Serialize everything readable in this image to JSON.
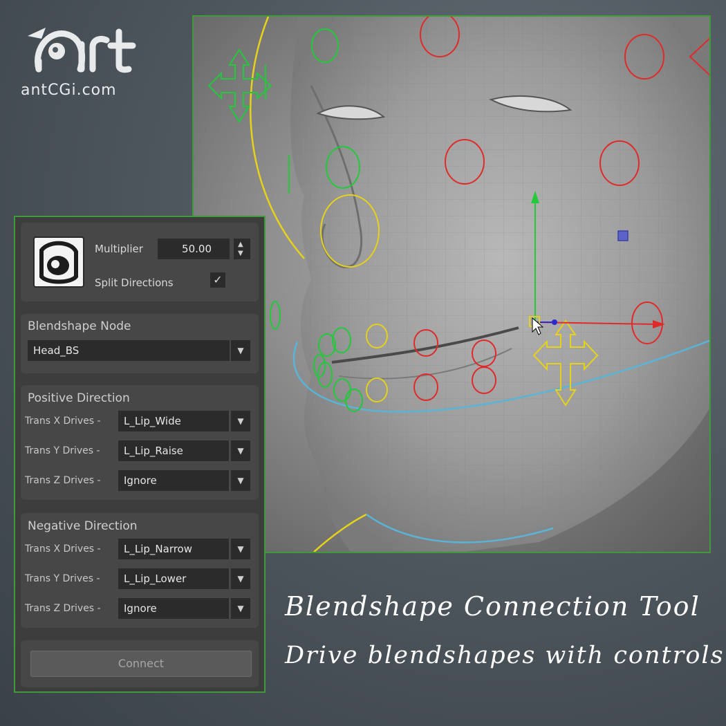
{
  "brand": {
    "logo_text": "Art",
    "site": "antCGi.com"
  },
  "panel": {
    "multiplier_label": "Multiplier",
    "multiplier_value": "50.00",
    "split_label": "Split Directions",
    "split_checked": "✓",
    "node_title": "Blendshape Node",
    "node_value": "Head_BS",
    "positive": {
      "title": "Positive Direction",
      "rows": [
        {
          "label": "Trans X Drives -",
          "value": "L_Lip_Wide"
        },
        {
          "label": "Trans Y Drives -",
          "value": "L_Lip_Raise"
        },
        {
          "label": "Trans Z Drives -",
          "value": "Ignore"
        }
      ]
    },
    "negative": {
      "title": "Negative Direction",
      "rows": [
        {
          "label": "Trans X Drives -",
          "value": "L_Lip_Narrow"
        },
        {
          "label": "Trans Y Drives -",
          "value": "L_Lip_Lower"
        },
        {
          "label": "Trans Z Drives -",
          "value": "Ignore"
        }
      ]
    },
    "connect_label": "Connect"
  },
  "headline": {
    "line1": "Blendshape Connection Tool",
    "line2": "Drive blendshapes with controls"
  },
  "colors": {
    "accent_green": "#3f9a3a",
    "ctrl_red": "#e02a2a",
    "ctrl_green": "#22c93a",
    "ctrl_yellow": "#e6d21a",
    "ctrl_cyan": "#5ab4d6"
  },
  "icons": [
    "spin-up-icon",
    "spin-down-icon",
    "checkmark-icon",
    "dropdown-arrow-icon",
    "move-manipulator-icon",
    "mouse-cursor-icon"
  ]
}
